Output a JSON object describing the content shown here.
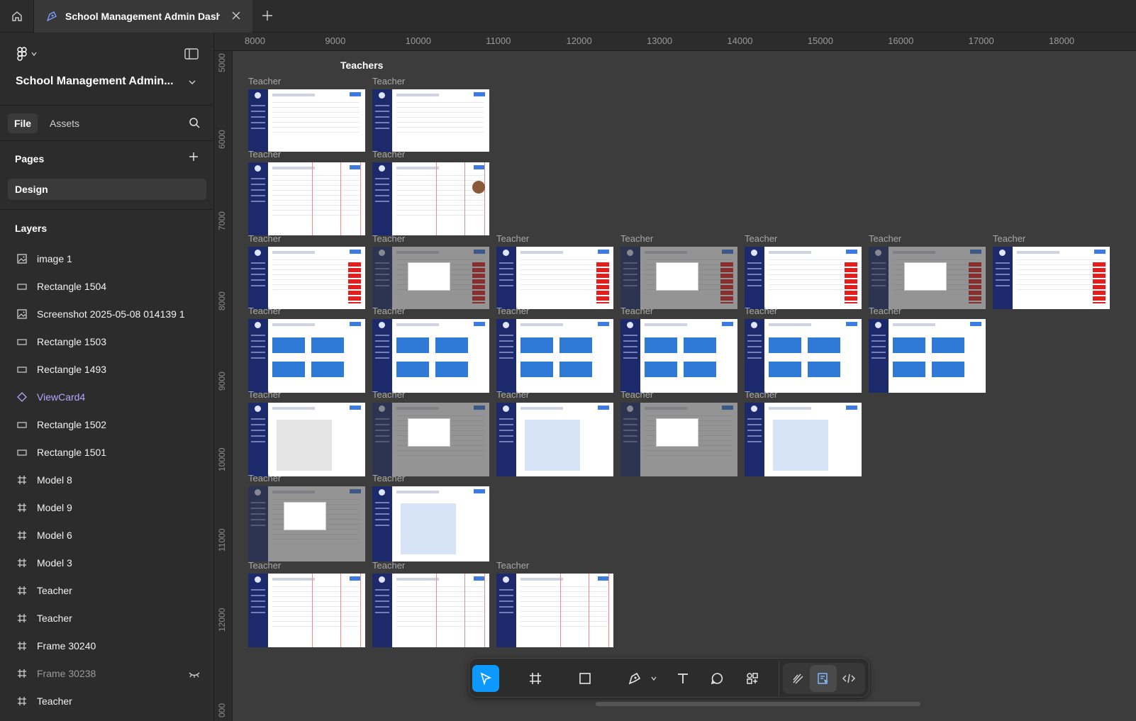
{
  "tab": {
    "title": "School Management Admin Dash"
  },
  "project": {
    "name": "School Management Admin..."
  },
  "panel_tabs": {
    "file": "File",
    "assets": "Assets"
  },
  "pages": {
    "label": "Pages",
    "items": [
      {
        "name": "Design"
      }
    ]
  },
  "layers": {
    "label": "Layers",
    "items": [
      {
        "name": "image 1",
        "icon": "image-icon"
      },
      {
        "name": "Rectangle 1504",
        "icon": "rectangle-icon"
      },
      {
        "name": "Screenshot 2025-05-08 014139 1",
        "icon": "image-icon"
      },
      {
        "name": "Rectangle 1503",
        "icon": "rectangle-icon"
      },
      {
        "name": "Rectangle 1493",
        "icon": "rectangle-icon"
      },
      {
        "name": "ViewCard4",
        "icon": "component-icon"
      },
      {
        "name": "Rectangle 1502",
        "icon": "rectangle-icon"
      },
      {
        "name": "Rectangle 1501",
        "icon": "rectangle-icon"
      },
      {
        "name": "Model 8",
        "icon": "frame-icon"
      },
      {
        "name": "Model 9",
        "icon": "frame-icon"
      },
      {
        "name": "Model 6",
        "icon": "frame-icon"
      },
      {
        "name": "Model 3",
        "icon": "frame-icon"
      },
      {
        "name": "Teacher",
        "icon": "frame-icon"
      },
      {
        "name": "Teacher",
        "icon": "frame-icon"
      },
      {
        "name": "Frame 30240",
        "icon": "frame-icon"
      },
      {
        "name": "Frame 30238",
        "icon": "frame-icon"
      },
      {
        "name": "Teacher",
        "icon": "frame-icon"
      }
    ]
  },
  "ruler": {
    "top": [
      "8000",
      "9000",
      "10000",
      "11000",
      "12000",
      "13000",
      "14000",
      "15000",
      "16000",
      "17000",
      "18000"
    ],
    "left": [
      "5000",
      "6000",
      "7000",
      "8000",
      "9000",
      "10000",
      "11000",
      "12000",
      "000"
    ]
  },
  "canvas": {
    "section_title": "Teachers",
    "frame_label": "Teacher"
  },
  "colors": {
    "accent": "#0d99ff",
    "sidebar_navy": "#1c2a6b",
    "danger_red": "#e0201f",
    "card_blue": "#2f7ad6"
  }
}
